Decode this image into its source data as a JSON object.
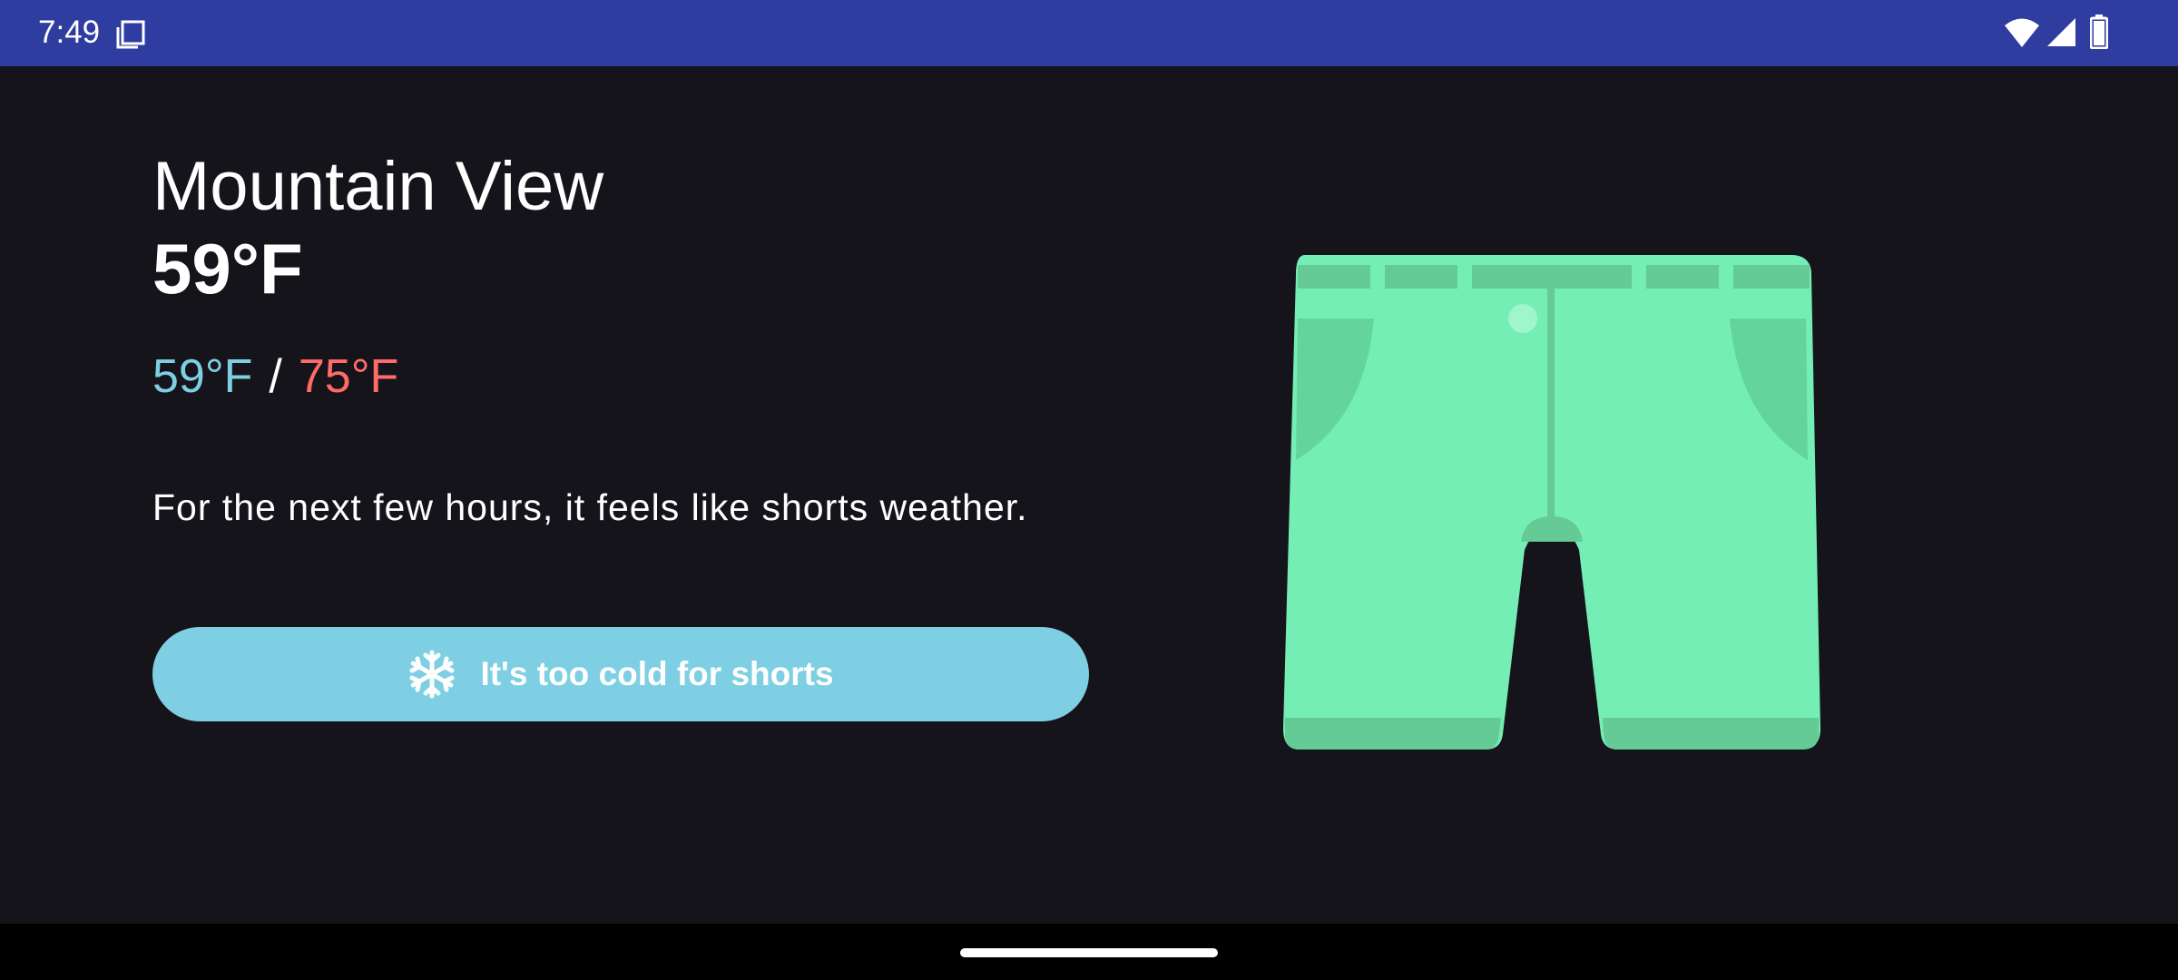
{
  "status_bar": {
    "time": "7:49",
    "icons": [
      "copy-icon",
      "wifi-icon",
      "signal-icon",
      "battery-icon"
    ]
  },
  "weather": {
    "city": "Mountain View",
    "current_temp": "59°F",
    "low_temp": "59°F",
    "separator": "/",
    "high_temp": "75°F",
    "message": "For the next few hours, it feels like shorts weather."
  },
  "action": {
    "label": "It's too cold for shorts",
    "icon": "snowflake-icon"
  },
  "illustration": {
    "name": "shorts-illustration",
    "color": "#74eeb4"
  },
  "colors": {
    "status_bar": "#2f3ca0",
    "background": "#16141b",
    "low_temp": "#7ecfe3",
    "high_temp": "#ff6b66",
    "button": "#7ecfe3"
  }
}
